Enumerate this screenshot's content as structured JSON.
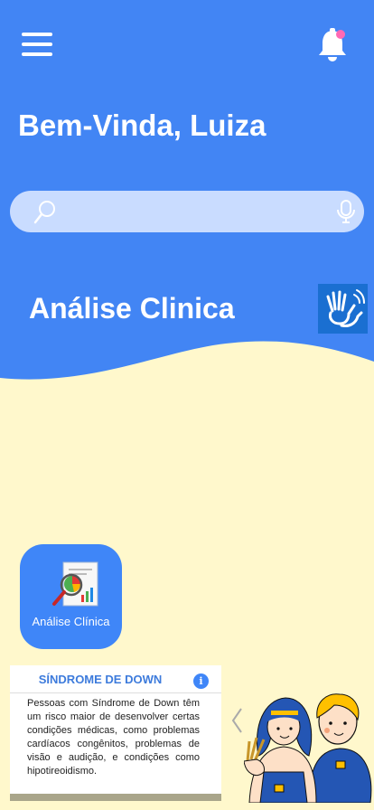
{
  "header": {
    "greeting": "Bem-Vinda, Luiza"
  },
  "search": {
    "placeholder": ""
  },
  "section": {
    "title": "Análise Clinica"
  },
  "feature_card": {
    "label": "Análise Clínica"
  },
  "info_card": {
    "title": "SÍNDROME DE DOWN",
    "info_glyph": "i",
    "text": "Pessoas com Síndrome de Down têm um risco maior de desenvolver certas condições médicas, como problemas cardíacos congênitos, problemas de visão e audição, e condições como hipotireoidismo."
  },
  "colors": {
    "primary_blue": "#4285f4",
    "background": "#fff8cc",
    "badge": "#ff69b4",
    "card_blue": "#3f86f8"
  }
}
